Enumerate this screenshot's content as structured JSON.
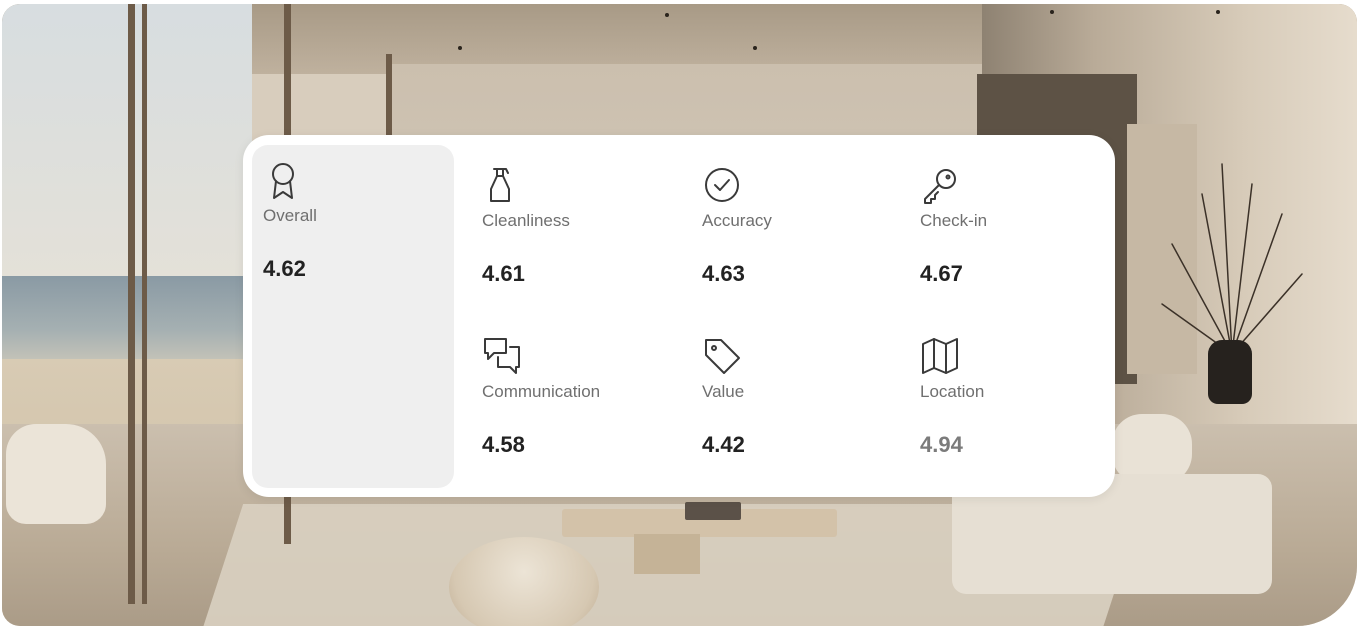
{
  "ratings": {
    "overall": {
      "label": "Overall",
      "value": "4.62",
      "icon": "award-ribbon-icon"
    },
    "categories": [
      {
        "label": "Cleanliness",
        "value": "4.61",
        "icon": "spray-bottle-icon"
      },
      {
        "label": "Accuracy",
        "value": "4.63",
        "icon": "check-circle-icon"
      },
      {
        "label": "Check-in",
        "value": "4.67",
        "icon": "key-icon"
      },
      {
        "label": "Communication",
        "value": "4.58",
        "icon": "chat-bubbles-icon"
      },
      {
        "label": "Value",
        "value": "4.42",
        "icon": "price-tag-icon"
      },
      {
        "label": "Location",
        "value": "4.94",
        "icon": "map-icon"
      }
    ]
  },
  "colors": {
    "card_bg": "#ffffff",
    "overall_bg": "#efefef",
    "label_text": "#6f6f6f",
    "value_text": "#222222"
  }
}
